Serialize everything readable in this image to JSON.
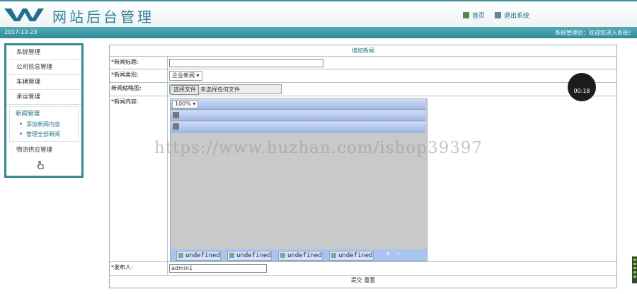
{
  "header": {
    "title": "网站后台管理",
    "nav": [
      {
        "label": "首页",
        "icon": "home-icon"
      },
      {
        "label": "退出系统",
        "icon": "logout-icon"
      }
    ]
  },
  "statusbar": {
    "date": "2017-12-23",
    "welcome": "系统管理员：欢迎您进入系统！"
  },
  "sidebar": {
    "items": [
      "系统管理",
      "公司信息管理",
      "车辆管理",
      "承运管理"
    ],
    "active_group": {
      "title": "新闻管理",
      "subitems": [
        "添加新闻内容",
        "管理全部新闻"
      ]
    },
    "last_item": "物流供应管理"
  },
  "form": {
    "title": "增加新闻",
    "fields": {
      "title_label": "*新闻标题:",
      "title_value": "",
      "category_label": "*新闻类别:",
      "category_value": "企业新闻",
      "image_label": "新闻缩略图:",
      "file_button": "选择文件",
      "file_status": "未选择任何文件",
      "content_label": "*新闻内容:",
      "zoom": "100%",
      "editor_buttons": [
        "undefined",
        "undefined",
        "undefined",
        "undefined"
      ],
      "publisher_label": "*发布人:",
      "publisher_value": "admin1"
    },
    "submit_label": "提交",
    "reset_label": "重置"
  },
  "overlay": {
    "timer": "00:18",
    "watermark": "https://www.huzhan.com/ishop39397"
  },
  "colors": {
    "accent": "#2f8c9a",
    "brand_text": "#2d7fa0",
    "editor_toolbar": "#9fb8e8"
  }
}
